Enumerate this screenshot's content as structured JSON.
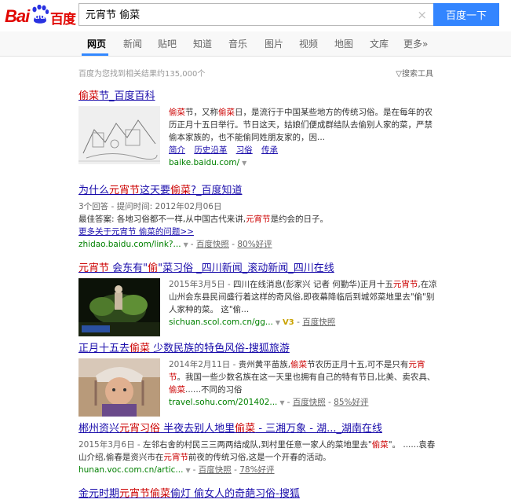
{
  "header": {
    "logo": {
      "bai": "Bai",
      "du": "du",
      "cn": "百度"
    },
    "query": "元宵节 偷菜",
    "clear_icon": "×",
    "search_button": "百度一下"
  },
  "tabs": [
    {
      "label": "网页",
      "active": true
    },
    {
      "label": "新闻"
    },
    {
      "label": "贴吧"
    },
    {
      "label": "知道"
    },
    {
      "label": "音乐"
    },
    {
      "label": "图片"
    },
    {
      "label": "视频"
    },
    {
      "label": "地图"
    },
    {
      "label": "文库"
    },
    {
      "label": "更多»"
    }
  ],
  "meta": {
    "result_count": "百度为您找到相关结果约135,000个",
    "search_tools": "搜索工具"
  },
  "results": [
    {
      "title_parts": [
        {
          "t": "偷菜",
          "em": true
        },
        {
          "t": "节_百度百科"
        }
      ],
      "abstract_parts": [
        {
          "t": "偷菜",
          "em": true
        },
        {
          "t": "节，又称"
        },
        {
          "t": "偷菜",
          "em": true
        },
        {
          "t": "日，是流行于中国某些地方的传统习俗。是在每年的农历正月十五日举行。节日这天，姑娘们便成群结队去偷别人家的菜，严禁偷本家族的，也不能偷同姓朋友家的，因..."
        }
      ],
      "sub_links": [
        "简介",
        "历史沿革",
        "习俗",
        "传承"
      ],
      "url": "baike.baidu.com/"
    },
    {
      "title_parts": [
        {
          "t": "为什么"
        },
        {
          "t": "元宵节",
          "em": true
        },
        {
          "t": "这天要"
        },
        {
          "t": "偷菜",
          "em": true
        },
        {
          "t": "?_百度知道"
        }
      ],
      "answers": "3个回答 - 提问时间: 2012年02月06日",
      "best_answer_parts": [
        {
          "t": "最佳答案: 各地习俗都不一样,从中国古代来讲,"
        },
        {
          "t": "元宵节",
          "em": true
        },
        {
          "t": "是约会的日子。"
        }
      ],
      "more": "更多关于元宵节 偷菜的问题>>",
      "url": "zhidao.baidu.com/link?...",
      "snapshot": "百度快照",
      "rating": "80%好评"
    },
    {
      "title_parts": [
        {
          "t": "元宵节",
          "em": true
        },
        {
          "t": " 会东有\""
        },
        {
          "t": "偷",
          "em": true
        },
        {
          "t": "\"菜习俗 _四川新闻_滚动新闻_四川在线"
        }
      ],
      "date": "2015年3月5日 - ",
      "abstract_parts": [
        {
          "t": "四川在线消息(彭家兴 记者 何勤华)正月十五"
        },
        {
          "t": "元宵节",
          "em": true
        },
        {
          "t": ",在凉山州会东县民间盛行着这样的奇风俗,即夜幕降临后到城郊菜地里去\"偷\"别人家种的菜。 这\"偷..."
        }
      ],
      "url": "sichuan.scol.com.cn/gg...",
      "v3": "V3",
      "snapshot": "百度快照"
    },
    {
      "title_parts": [
        {
          "t": "正月十五去"
        },
        {
          "t": "偷菜",
          "em": true
        },
        {
          "t": " 少数民族的特色风俗-搜狐旅游"
        }
      ],
      "date": "2014年2月11日 - ",
      "abstract_parts": [
        {
          "t": "贵州黄平苗族,"
        },
        {
          "t": "偷菜",
          "em": true
        },
        {
          "t": "节农历正月十五,可不是只有"
        },
        {
          "t": "元宵节",
          "em": true
        },
        {
          "t": "。我国一些少数名族在这一天里也拥有自己的特有节日,比美、卖农具、"
        },
        {
          "t": "偷菜",
          "em": true
        },
        {
          "t": "......不同的习俗"
        }
      ],
      "url": "travel.sohu.com/201402...",
      "snapshot": "百度快照",
      "rating": "85%好评"
    },
    {
      "title_parts": [
        {
          "t": "郴州资兴"
        },
        {
          "t": "元宵习俗",
          "em": true
        },
        {
          "t": " 半夜去别人地里"
        },
        {
          "t": "偷菜",
          "em": true
        },
        {
          "t": " - 三湘万象 - 湖..._湖南在线"
        }
      ],
      "date": "2015年3月6日 - ",
      "abstract_parts": [
        {
          "t": "左邻右舍的村民三三两两结成队,到村里任意一家人的菜地里去\""
        },
        {
          "t": "偷菜",
          "em": true
        },
        {
          "t": "\"。 ......袁春山介绍,偷春是资兴市在"
        },
        {
          "t": "元宵节",
          "em": true
        },
        {
          "t": "前夜的传统习俗,这是一个开春的活动。"
        }
      ],
      "url": "hunan.voc.com.cn/artic...",
      "snapshot": "百度快照",
      "rating": "78%好评"
    },
    {
      "title_parts": [
        {
          "t": "金元时期"
        },
        {
          "t": "元宵节偷菜",
          "em": true
        },
        {
          "t": "偷灯 偷女人的奇葩习俗-搜狐"
        }
      ]
    }
  ]
}
